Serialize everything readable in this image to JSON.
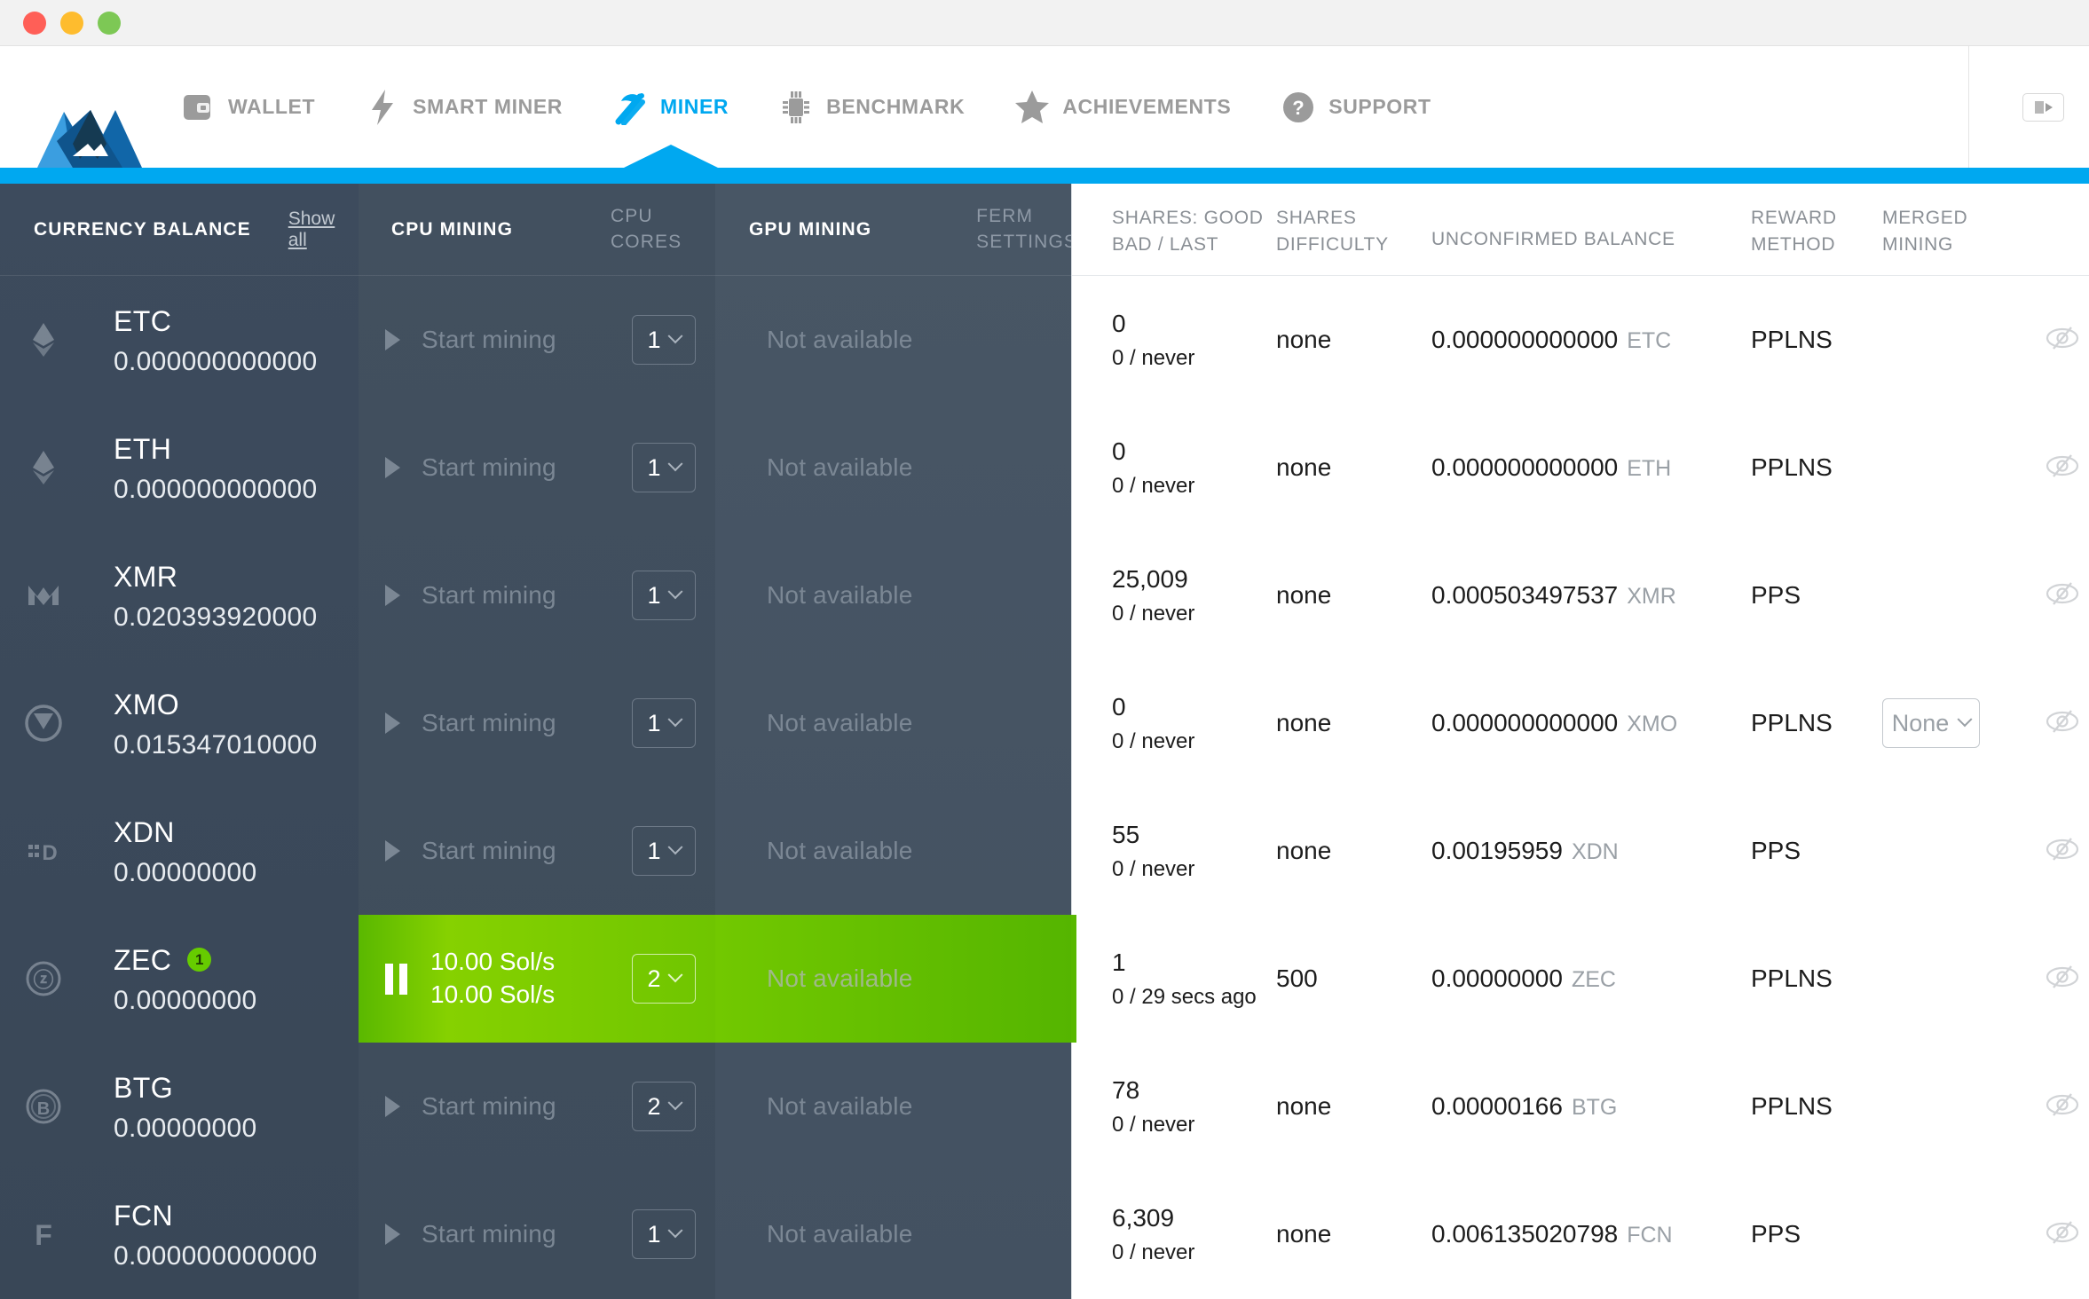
{
  "window": {
    "controls": [
      "close",
      "minimize",
      "maximize"
    ]
  },
  "nav": {
    "items": [
      {
        "label": "WALLET",
        "icon": "wallet-icon",
        "active": false
      },
      {
        "label": "SMART MINER",
        "icon": "bolt-icon",
        "active": false
      },
      {
        "label": "MINER",
        "icon": "pickaxe-icon",
        "active": true
      },
      {
        "label": "BENCHMARK",
        "icon": "chip-icon",
        "active": false
      },
      {
        "label": "ACHIEVEMENTS",
        "icon": "star-icon",
        "active": false
      },
      {
        "label": "SUPPORT",
        "icon": "question-icon",
        "active": false
      }
    ],
    "collapse_icon": "collapse-icon",
    "accent_color": "#00a8f0"
  },
  "headers": {
    "currency_balance": "CURRENCY BALANCE",
    "show_all": "Show all",
    "cpu_mining": "CPU MINING",
    "cpu_cores": "CPU\nCORES",
    "cpu_cores_line1": "CPU",
    "cpu_cores_line2": "CORES",
    "gpu_mining": "GPU MINING",
    "ferm_settings_line1": "FERM",
    "ferm_settings_line2": "SETTINGS",
    "shares_line1": "SHARES: GOOD",
    "shares_line2": "BAD / LAST",
    "shares_difficulty_line1": "SHARES",
    "shares_difficulty_line2": "DIFFICULTY",
    "unconfirmed_balance": "UNCONFIRMED BALANCE",
    "reward_line1": "REWARD",
    "reward_line2": "METHOD",
    "merged_line1": "MERGED",
    "merged_line2": "MINING"
  },
  "colors": {
    "accent": "#00a8f0",
    "active_row_green": "#76cc00",
    "panel_dark": "#3c4a5c",
    "badge_green": "#66cc00"
  },
  "rows": [
    {
      "currency": "ETC",
      "balance": "0.000000000000",
      "icon": "etc-icon",
      "badge": null,
      "cpu_state": "idle",
      "cpu_label": "Start mining",
      "cpu_cores": "1",
      "gpu_label": "Not available",
      "shares_good": "0",
      "shares_bad_last": "0 / never",
      "shares_difficulty": "none",
      "unconfirmed_balance": "0.000000000000",
      "unconfirmed_currency": "ETC",
      "reward_method": "PPLNS",
      "merged_mining": null,
      "hidden_icon": "eye-off-icon"
    },
    {
      "currency": "ETH",
      "balance": "0.000000000000",
      "icon": "eth-icon",
      "badge": null,
      "cpu_state": "idle",
      "cpu_label": "Start mining",
      "cpu_cores": "1",
      "gpu_label": "Not available",
      "shares_good": "0",
      "shares_bad_last": "0 / never",
      "shares_difficulty": "none",
      "unconfirmed_balance": "0.000000000000",
      "unconfirmed_currency": "ETH",
      "reward_method": "PPLNS",
      "merged_mining": null,
      "hidden_icon": "eye-off-icon"
    },
    {
      "currency": "XMR",
      "balance": "0.020393920000",
      "icon": "monero-icon",
      "badge": null,
      "cpu_state": "idle",
      "cpu_label": "Start mining",
      "cpu_cores": "1",
      "gpu_label": "Not available",
      "shares_good": "25,009",
      "shares_bad_last": "0 / never",
      "shares_difficulty": "none",
      "unconfirmed_balance": "0.000503497537",
      "unconfirmed_currency": "XMR",
      "reward_method": "PPS",
      "merged_mining": null,
      "hidden_icon": "eye-off-icon"
    },
    {
      "currency": "XMO",
      "balance": "0.015347010000",
      "icon": "monetaverde-icon",
      "badge": null,
      "cpu_state": "idle",
      "cpu_label": "Start mining",
      "cpu_cores": "1",
      "gpu_label": "Not available",
      "shares_good": "0",
      "shares_bad_last": "0 / never",
      "shares_difficulty": "none",
      "unconfirmed_balance": "0.000000000000",
      "unconfirmed_currency": "XMO",
      "reward_method": "PPLNS",
      "merged_mining": "None",
      "hidden_icon": "eye-off-icon"
    },
    {
      "currency": "XDN",
      "balance": "0.00000000",
      "icon": "digitalnote-icon",
      "badge": null,
      "cpu_state": "idle",
      "cpu_label": "Start mining",
      "cpu_cores": "1",
      "gpu_label": "Not available",
      "shares_good": "55",
      "shares_bad_last": "0 / never",
      "shares_difficulty": "none",
      "unconfirmed_balance": "0.00195959",
      "unconfirmed_currency": "XDN",
      "reward_method": "PPS",
      "merged_mining": null,
      "hidden_icon": "eye-off-icon"
    },
    {
      "currency": "ZEC",
      "balance": "0.00000000",
      "icon": "zcash-icon",
      "badge": "1",
      "cpu_state": "mining",
      "cpu_hashrate_line1": "10.00 Sol/s",
      "cpu_hashrate_line2": "10.00 Sol/s",
      "cpu_cores": "2",
      "gpu_label": "Not available",
      "shares_good": "1",
      "shares_bad_last": "0 / 29 secs ago",
      "shares_difficulty": "500",
      "unconfirmed_balance": "0.00000000",
      "unconfirmed_currency": "ZEC",
      "reward_method": "PPLNS",
      "merged_mining": null,
      "hidden_icon": "eye-off-icon"
    },
    {
      "currency": "BTG",
      "balance": "0.00000000",
      "icon": "bitcoingold-icon",
      "badge": null,
      "cpu_state": "idle",
      "cpu_label": "Start mining",
      "cpu_cores": "2",
      "gpu_label": "Not available",
      "shares_good": "78",
      "shares_bad_last": "0 / never",
      "shares_difficulty": "none",
      "unconfirmed_balance": "0.00000166",
      "unconfirmed_currency": "BTG",
      "reward_method": "PPLNS",
      "merged_mining": null,
      "hidden_icon": "eye-off-icon"
    },
    {
      "currency": "FCN",
      "balance": "0.000000000000",
      "icon": "fantomcoin-icon",
      "badge": null,
      "cpu_state": "idle",
      "cpu_label": "Start mining",
      "cpu_cores": "1",
      "gpu_label": "Not available",
      "shares_good": "6,309",
      "shares_bad_last": "0 / never",
      "shares_difficulty": "none",
      "unconfirmed_balance": "0.006135020798",
      "unconfirmed_currency": "FCN",
      "reward_method": "PPS",
      "merged_mining": null,
      "hidden_icon": "eye-off-icon"
    }
  ]
}
